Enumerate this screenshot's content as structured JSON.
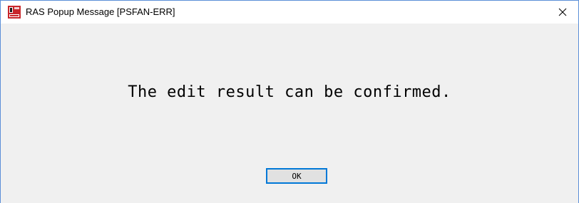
{
  "window": {
    "title": "RAS Popup Message [PSFAN-ERR]",
    "app_icon": "ras-app-icon",
    "close_icon": "close-icon",
    "close_glyph": "✕"
  },
  "dialog": {
    "message": "The edit result can be confirmed.",
    "ok_label": "OK"
  },
  "colors": {
    "border": "#5b8fd8",
    "client_background": "#f0f0f0",
    "titlebar_background": "#ffffff",
    "button_focus_border": "#0078d7",
    "icon_red": "#c8262a"
  }
}
